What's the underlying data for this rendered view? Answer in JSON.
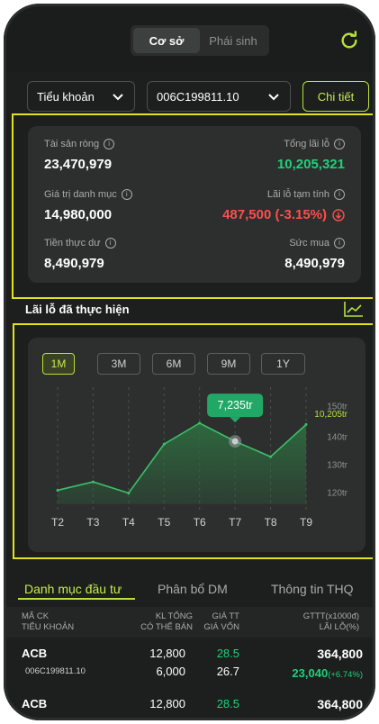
{
  "header": {
    "tabs": [
      {
        "label": "Cơ sở",
        "active": true
      },
      {
        "label": "Phái sinh",
        "active": false
      }
    ],
    "refresh_icon": "refresh-icon"
  },
  "filters": {
    "account_type": "Tiểu khoản",
    "account_no": "006C199811.10",
    "detail_button": "Chi tiết"
  },
  "summary": {
    "net_assets_label": "Tài sản ròng",
    "net_assets_value": "23,470,979",
    "total_pl_label": "Tổng lãi lỗ",
    "total_pl_value": "10,205,321",
    "portfolio_value_label": "Giá trị danh mục",
    "portfolio_value_value": "14,980,000",
    "temp_pl_label": "Lãi lỗ tạm tính",
    "temp_pl_value": "487,500 (-3.15%)",
    "cash_label": "Tiền thực dư",
    "cash_value": "8,490,979",
    "buying_power_label": "Sức mua",
    "buying_power_value": "8,490,979"
  },
  "realized": {
    "title": "Lãi lỗ đã thực hiện",
    "ranges": [
      "1M",
      "3M",
      "6M",
      "9M",
      "1Y"
    ],
    "active_range": "1M",
    "tooltip": "7,235tr",
    "current_label": "10,205tr"
  },
  "chart_data": {
    "type": "area",
    "categories": [
      "T2",
      "T3",
      "T4",
      "T5",
      "T6",
      "T7",
      "T8",
      "T9"
    ],
    "y_tick_labels": [
      "150tr",
      "140tr",
      "130tr",
      "120tr"
    ],
    "y_ticks": [
      150,
      140,
      130,
      120
    ],
    "ylim": [
      116,
      153
    ],
    "values": [
      121,
      124,
      120,
      137.5,
      145,
      138.5,
      133,
      144.5
    ],
    "highlight_index": 5,
    "colors": {
      "line": "#3bc16a",
      "fill": "#2e6b3f",
      "dot": "#9aa09e"
    }
  },
  "bottom_tabs": [
    {
      "label": "Danh mục đầu tư",
      "active": true
    },
    {
      "label": "Phân bổ DM",
      "active": false
    },
    {
      "label": "Thông tin THQ",
      "active": false
    }
  ],
  "table": {
    "headers": {
      "col1_line1": "MÃ CK",
      "col1_line2": "TIỂU KHOẢN",
      "col2_line1": "KL TỔNG",
      "col2_line2": "CÓ THỂ BÁN",
      "col3_line1": "GIÁ TT",
      "col3_line2": "GIÁ VỐN",
      "col4_line1": "GTTT(x1000đ)",
      "col4_line2": "LÃI LỖ(%)"
    },
    "rows": [
      {
        "symbol": "ACB",
        "account": "006C199811.10",
        "kl_total": "12,800",
        "kl_sell": "6,000",
        "price": "28.5",
        "cost": "26.7",
        "value": "364,800",
        "pl": "23,040",
        "pl_pct": "(+6.74%)"
      },
      {
        "symbol": "ACB",
        "account": "",
        "kl_total": "12,800",
        "kl_sell": "",
        "price": "28.5",
        "cost": "",
        "value": "364,800",
        "pl": "",
        "pl_pct": ""
      }
    ]
  }
}
